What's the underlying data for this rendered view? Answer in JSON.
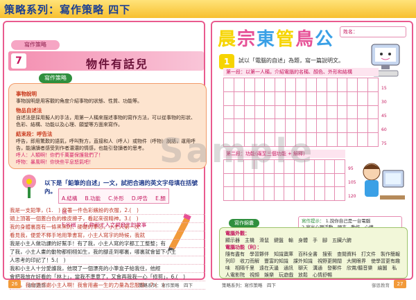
{
  "header": {
    "title": "策略系列：寫作策略 四下"
  },
  "left": {
    "tag": "寫作策略",
    "unit_number": "7",
    "title": "物件有話兒",
    "strategy_label": "寫作策略",
    "sections": [
      {
        "heading": "事物說明",
        "text": "事物說明是用客觀的角度介紹事物的狀態、性質、功能等。"
      },
      {
        "heading": "物品自述法",
        "text": "自述法是採用擬人的手法，用第一人稱來描述事物的寫作方法，可以從事物的形狀、色彩、結構、功能以及心理、願望等方面來寫作。"
      },
      {
        "heading": "結束段：呼告法",
        "text": "呼告，即用驚歎的語氣，呼叫對方，直接和人（呼人）或物件（呼物）說話，運用呼告，能讓讀者感受到作者濃濃的情感，也能引發讀者的思考。"
      }
    ],
    "examples": [
      "呼人：人類啊！你們千萬要保護我們了！",
      "呼物：暴風啊！你快些平息怒氣吧！"
    ],
    "exercise_label": "以下是「鉛筆的自述」一文，試把合適的英文字母填在括號內。",
    "options": [
      "A.結構",
      "B.功能",
      "C.外形",
      "D.呼告",
      "E.顏色",
      "F.名稱",
      "G.你和主人之間發生的故事"
    ],
    "story": [
      "我是一支鉛筆，(1.　) 穿著一件色彩繽紛的衣服，2.(　)",
      "頭上頂著一個蓋白色的橡皮擦子，看起來很精神。3.(　)",
      "我的身體裏面有一條黑黑的、硬硬的筆芯，小主人第一次",
      "看見我，便愛不釋手地用筆書寫，小主人寫字的時候，我就",
      "我是小主人做功課的好幫手！有了我，小主人寫的字都工工整整；有",
      "了我，小主人畫的動物都栩栩如生，我的腳走到哪裏，哪裏就會留下小主",
      "人思考的印記了！5.(　)",
      "我和小主人十分愛護我，他現了一個漂亮的小筆盒子給我住，他經",
      "會把我放在好看的「林上」，當我不準意了，又會再我我一心「修剪」，6.(　)",
      "可是，我會更感謝小主人啊！我會用盡一生的力量為您服務！7.(　)"
    ],
    "page_number": "26",
    "footer": "策略系列：寫作策略　四下",
    "logo": "御恩教育"
  },
  "right": {
    "rainbow_title": [
      "晨",
      "宗",
      "東",
      "管",
      "鳥",
      "公"
    ],
    "name_label": "姓名：",
    "prompt_icon": "1",
    "prompt": "試以「電腦的自述」為題，寫一篇說明文。",
    "part1_label": "第一段：以第一人稱，介紹電腦的名稱、顏色、外形和結構",
    "part2_label": "第二段：功能(兩至三個功能 + 解釋)",
    "row_numbers_1": [
      "15",
      "30",
      "45",
      "60",
      "75"
    ],
    "row_numbers_2": [
      "95",
      "105",
      "120"
    ],
    "vocab_label": "寫作錦囊",
    "hint_title": "寫作提示：",
    "hints": [
      "1.說你自己是一台電腦",
      "2.寫出心理活動、頭言、動作、心情"
    ],
    "vocab_sections": [
      {
        "heading": "電腦外觀：",
        "words": "顯示器　主機　滑鼠　鍵盤　輸　身體　手　腳　五臟六腑"
      },
      {
        "heading": "電腦功能（利）：",
        "words": "隨有盡有　學習夥伴　知識寶庫　百科全書　搜索　查閱資料　打文件　製作簡報　列印　收刀而解　豐富的知識　課外知識　視野更開闊　大開眼界　使學習更有趣味　相隔千里　遠在天邊　通訊　聊天　溝通　發郵件　欣賞/聽音樂　繪圖　私人電影院　視頻　娛樂　玩遊戲　放鬆　心情舒暢"
      }
    ],
    "page_number": "27",
    "footer": "策略系列：寫作策略　四下",
    "logo": "御恩教育"
  },
  "watermark": "Sample"
}
